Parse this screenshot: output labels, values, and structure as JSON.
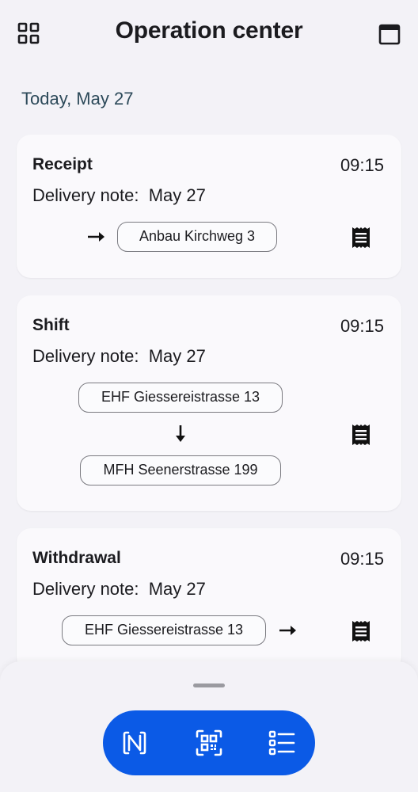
{
  "header": {
    "title": "Operation center",
    "left_icon": "grid-menu-icon",
    "right_icon": "calendar-icon"
  },
  "date_heading": "Today, May 27",
  "cards": [
    {
      "type": "Receipt",
      "time": "09:15",
      "note": "Delivery note:  May 27",
      "to": "Anbau Kirchweg 3",
      "arrow_icon": "arrow-right-icon",
      "doc_icon": "receipt-icon"
    },
    {
      "type": "Shift",
      "time": "09:15",
      "note": "Delivery note:  May 27",
      "from": "EHF Giessereistrasse 13",
      "to": "MFH Seenerstrasse 199",
      "arrow_icon": "arrow-down-icon",
      "doc_icon": "receipt-icon"
    },
    {
      "type": "Withdrawal",
      "time": "09:15",
      "note": "Delivery note:  May 27",
      "from": "EHF Giessereistrasse 13",
      "arrow_icon": "arrow-right-icon",
      "doc_icon": "receipt-icon"
    }
  ],
  "bottom_bar": {
    "actions": [
      "nfc-icon",
      "qr-scan-icon",
      "list-icon"
    ],
    "accent": "#0b5ae6"
  }
}
